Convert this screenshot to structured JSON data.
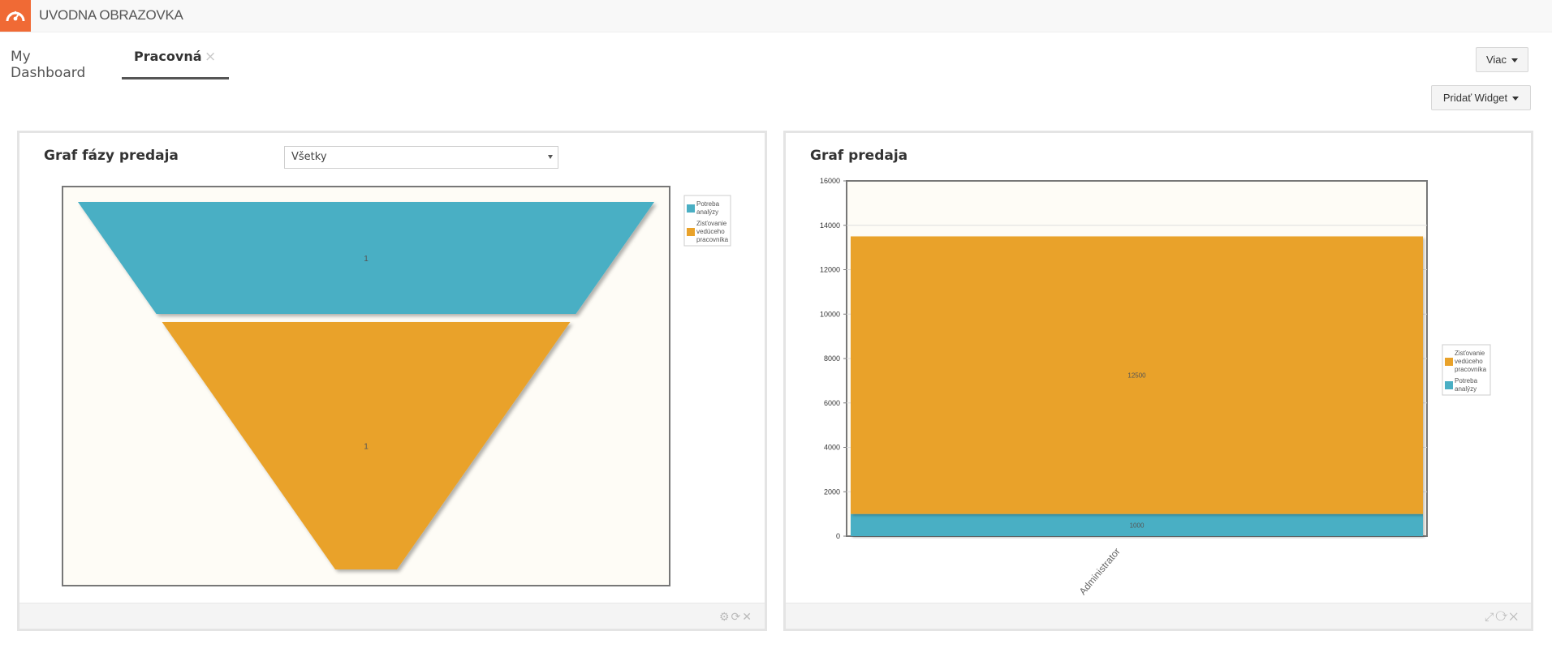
{
  "app": {
    "title": "UVODNA OBRAZOVKA",
    "logo_icon": "dashboard-gauge-icon",
    "accent": "#f06a35"
  },
  "tabs": [
    {
      "label": "My Dashboard",
      "active": false
    },
    {
      "label": "Pracovná",
      "active": true,
      "close_glyph": "×"
    }
  ],
  "toolbar": {
    "more_label": "Viac",
    "add_widget_label": "Pridať Widget"
  },
  "widgets": {
    "funnel": {
      "title": "Graf fázy predaja",
      "filter_value": "Všetky",
      "footer_icons": [
        "gear-icon",
        "refresh-icon",
        "close-icon"
      ]
    },
    "bar": {
      "title": "Graf predaja",
      "footer_icons": [
        "expand-icon",
        "refresh-icon",
        "close-icon"
      ]
    }
  },
  "colors": {
    "teal": "#4aafc4",
    "orange": "#e9a22a",
    "plot_bg": "#fefcf6"
  },
  "chart_data": [
    {
      "type": "funnel",
      "stages": [
        {
          "name": "Potreba analýzy",
          "value": 1,
          "color": "#4aafc4"
        },
        {
          "name": "Zisťovanie vedúceho pracovníka",
          "value": 1,
          "color": "#e9a22a"
        }
      ],
      "legend": {
        "placement": "right",
        "entries": [
          {
            "lines": [
              "Potreba",
              "analýzy"
            ],
            "color": "#4aafc4"
          },
          {
            "lines": [
              "Zisťovanie",
              "vedúceho",
              "pracovníka"
            ],
            "color": "#e9a22a"
          }
        ]
      }
    },
    {
      "type": "bar",
      "stacked": true,
      "categories": [
        "Administrator"
      ],
      "series": [
        {
          "name": "Potreba analýzy",
          "values": [
            1000
          ],
          "color": "#4aafc4"
        },
        {
          "name": "Zisťovanie vedúceho pracovníka",
          "values": [
            12500
          ],
          "color": "#e9a22a"
        }
      ],
      "ylim": [
        0,
        16000
      ],
      "yticks": [
        0,
        2000,
        4000,
        6000,
        8000,
        10000,
        12000,
        14000,
        16000
      ],
      "grid": true,
      "legend": {
        "placement": "right",
        "entries": [
          {
            "lines": [
              "Zisťovanie",
              "vedúceho",
              "pracovníka"
            ],
            "color": "#e9a22a"
          },
          {
            "lines": [
              "Potreba",
              "analýzy"
            ],
            "color": "#4aafc4"
          }
        ]
      }
    }
  ]
}
